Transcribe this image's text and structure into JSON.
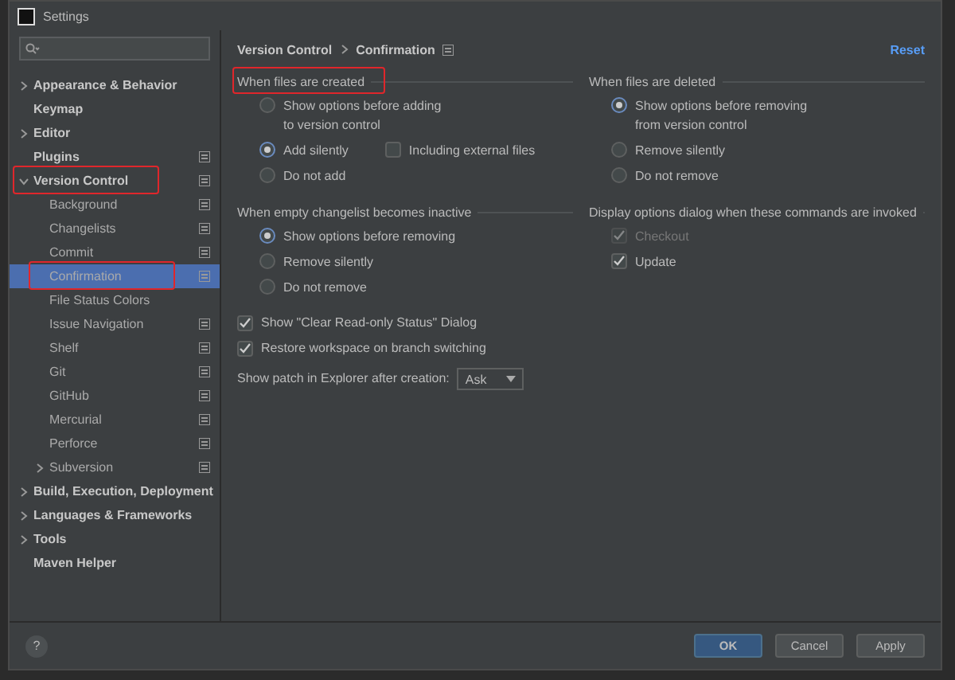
{
  "window": {
    "title": "Settings"
  },
  "help": "?",
  "sidebar": {
    "items": [
      {
        "label": "Appearance & Behavior",
        "expandable": true,
        "expanded": false,
        "project_icon": false,
        "selected": false,
        "highlighted": false
      },
      {
        "label": "Keymap",
        "expandable": false,
        "project_icon": false,
        "selected": false,
        "highlighted": false
      },
      {
        "label": "Editor",
        "expandable": true,
        "expanded": false,
        "project_icon": false,
        "selected": false,
        "highlighted": false
      },
      {
        "label": "Plugins",
        "expandable": false,
        "project_icon": true,
        "selected": false,
        "highlighted": false
      },
      {
        "label": "Version Control",
        "expandable": true,
        "expanded": true,
        "project_icon": true,
        "selected": false,
        "highlighted": true,
        "children": [
          {
            "label": "Background",
            "expandable": false,
            "project_icon": true,
            "selected": false,
            "highlighted": false
          },
          {
            "label": "Changelists",
            "expandable": false,
            "project_icon": true,
            "selected": false,
            "highlighted": false
          },
          {
            "label": "Commit",
            "expandable": false,
            "project_icon": true,
            "selected": false,
            "highlighted": false
          },
          {
            "label": "Confirmation",
            "expandable": false,
            "project_icon": true,
            "selected": true,
            "highlighted": true
          },
          {
            "label": "File Status Colors",
            "expandable": false,
            "project_icon": false,
            "selected": false,
            "highlighted": false
          },
          {
            "label": "Issue Navigation",
            "expandable": false,
            "project_icon": true,
            "selected": false,
            "highlighted": false
          },
          {
            "label": "Shelf",
            "expandable": false,
            "project_icon": true,
            "selected": false,
            "highlighted": false
          },
          {
            "label": "Git",
            "expandable": false,
            "project_icon": true,
            "selected": false,
            "highlighted": false
          },
          {
            "label": "GitHub",
            "expandable": false,
            "project_icon": true,
            "selected": false,
            "highlighted": false
          },
          {
            "label": "Mercurial",
            "expandable": false,
            "project_icon": true,
            "selected": false,
            "highlighted": false
          },
          {
            "label": "Perforce",
            "expandable": false,
            "project_icon": true,
            "selected": false,
            "highlighted": false
          },
          {
            "label": "Subversion",
            "expandable": true,
            "expanded": false,
            "project_icon": true,
            "selected": false,
            "highlighted": false
          }
        ]
      },
      {
        "label": "Build, Execution, Deployment",
        "expandable": true,
        "expanded": false,
        "project_icon": false,
        "selected": false,
        "highlighted": false
      },
      {
        "label": "Languages & Frameworks",
        "expandable": true,
        "expanded": false,
        "project_icon": false,
        "selected": false,
        "highlighted": false
      },
      {
        "label": "Tools",
        "expandable": true,
        "expanded": false,
        "project_icon": false,
        "selected": false,
        "highlighted": false
      },
      {
        "label": "Maven Helper",
        "expandable": false,
        "project_icon": false,
        "selected": false,
        "highlighted": false
      }
    ]
  },
  "breadcrumb": [
    "Version Control",
    "Confirmation"
  ],
  "reset": "Reset",
  "sections": [
    {
      "title": "When files are created",
      "highlighted": true,
      "options": [
        {
          "kind": "radio",
          "label": "Show options before adding\nto version control",
          "selected": false,
          "disabled": false
        },
        {
          "kind": "radio",
          "label": "Add silently",
          "selected": true,
          "disabled": false,
          "extra": {
            "label": "Including external files",
            "checked": false
          }
        },
        {
          "kind": "radio",
          "label": "Do not add",
          "selected": false,
          "disabled": false
        }
      ]
    },
    {
      "title": "When files are deleted",
      "highlighted": false,
      "options": [
        {
          "kind": "radio",
          "label": "Show options before removing\nfrom version control",
          "selected": true,
          "disabled": false
        },
        {
          "kind": "radio",
          "label": "Remove silently",
          "selected": false,
          "disabled": false
        },
        {
          "kind": "radio",
          "label": "Do not remove",
          "selected": false,
          "disabled": false
        }
      ]
    },
    {
      "title": "When empty changelist becomes inactive",
      "highlighted": false,
      "options": [
        {
          "kind": "radio",
          "label": "Show options before removing",
          "selected": true,
          "disabled": false
        },
        {
          "kind": "radio",
          "label": "Remove silently",
          "selected": false,
          "disabled": false
        },
        {
          "kind": "radio",
          "label": "Do not remove",
          "selected": false,
          "disabled": false
        }
      ]
    },
    {
      "title": "Display options dialog when these commands are invoked",
      "highlighted": false,
      "options": [
        {
          "kind": "checkbox",
          "label": "Checkout",
          "checked": true,
          "disabled": true
        },
        {
          "kind": "checkbox",
          "label": "Update",
          "checked": true,
          "disabled": false
        }
      ]
    }
  ],
  "checks": [
    {
      "label": "Show \"Clear Read-only Status\" Dialog",
      "checked": true
    },
    {
      "label": "Restore workspace on branch switching",
      "checked": true
    }
  ],
  "patch": {
    "label": "Show patch in Explorer after creation:",
    "value": "Ask"
  },
  "buttons": [
    {
      "label": "OK",
      "primary": true
    },
    {
      "label": "Cancel",
      "primary": false
    },
    {
      "label": "Apply",
      "primary": false
    }
  ]
}
